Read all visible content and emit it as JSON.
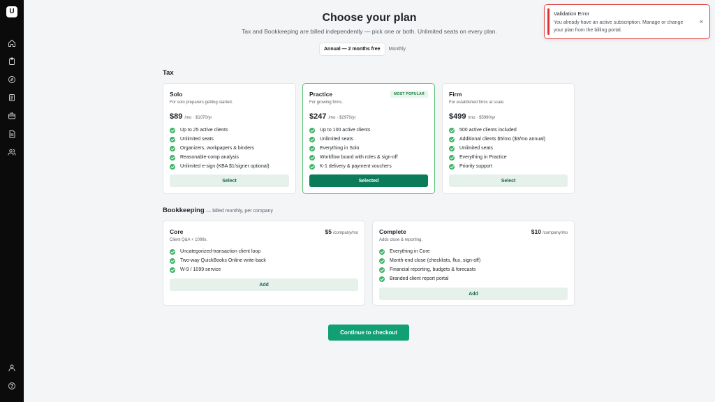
{
  "logo_letter": "U",
  "sidebar": {
    "icons": [
      "home-icon",
      "clipboard-icon",
      "compass-icon",
      "document-list-icon",
      "briefcase-icon",
      "file-text-icon",
      "users-icon"
    ],
    "bottom_icons": [
      "user-icon",
      "help-icon"
    ]
  },
  "header": {
    "title": "Choose your plan",
    "subtitle": "Tax and Bookkeeping are billed independently — pick one or both. Unlimited seats on every plan."
  },
  "billing_toggle": {
    "annual_label": "Annual — 2 months free",
    "monthly_label": "Monthly",
    "selected": "annual"
  },
  "tax": {
    "section_title": "Tax",
    "plans": [
      {
        "name": "Solo",
        "description": "For solo preparers getting started.",
        "price": "$89",
        "unit": "/mo",
        "annual": "· $1070/yr",
        "features": [
          "Up to 25 active clients",
          "Unlimited seats",
          "Organizers, workpapers & binders",
          "Reasonable-comp analysis",
          "Unlimited e-sign (KBA $1/signer optional)"
        ],
        "button_label": "Select"
      },
      {
        "name": "Practice",
        "badge": "MOST POPULAR",
        "description": "For growing firms.",
        "price": "$247",
        "unit": "/mo",
        "annual": "· $2970/yr",
        "features": [
          "Up to 100 active clients",
          "Unlimited seats",
          "Everything in Solo",
          "Workflow board with roles & sign-off",
          "K-1 delivery & payment vouchers"
        ],
        "button_label": "Selected"
      },
      {
        "name": "Firm",
        "description": "For established firms at scale.",
        "price": "$499",
        "unit": "/mo",
        "annual": "· $5990/yr",
        "features": [
          "500 active clients included",
          "Additional clients $5/mo ($3/mo annual)",
          "Unlimited seats",
          "Everything in Practice",
          "Priority support"
        ],
        "button_label": "Select"
      }
    ]
  },
  "bookkeeping": {
    "section_title": "Bookkeeping",
    "section_subtitle": "— billed monthly, per company",
    "plans": [
      {
        "name": "Core",
        "description": "Client Q&A + 1099s.",
        "price": "$5",
        "unit": "/company/mo",
        "features": [
          "Uncategorized-transaction client loop",
          "Two-way QuickBooks Online write-back",
          "W-9 / 1099 service"
        ],
        "button_label": "Add"
      },
      {
        "name": "Complete",
        "description": "Adds close & reporting.",
        "price": "$10",
        "unit": "/company/mo",
        "features": [
          "Everything in Core",
          "Month-end close (checklists, flux, sign-off)",
          "Financial reporting, budgets & forecasts",
          "Branded client report portal"
        ],
        "button_label": "Add"
      }
    ]
  },
  "checkout_label": "Continue to checkout",
  "toast": {
    "title": "Validation Error",
    "message": "You already have an active subscription. Manage or change your plan from the billing portal.",
    "close_glyph": "×"
  },
  "colors": {
    "accent": "#10a074",
    "accent_dark": "#0a7c59",
    "selected_border": "#5cc174",
    "error": "#d93535"
  }
}
